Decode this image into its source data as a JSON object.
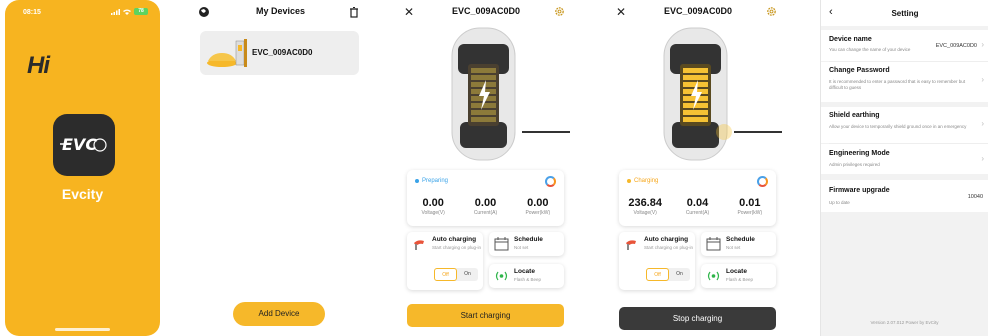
{
  "splash": {
    "time": "08:15",
    "battery": "78",
    "greeting": "Hi",
    "logo_text": "EVC",
    "brand": "Evcity"
  },
  "devices": {
    "title": "My Devices",
    "device_name": "EVC_009AC0D0",
    "add_label": "Add Device"
  },
  "preparing": {
    "title": "EVC_009AC0D0",
    "status": "Preparing",
    "status_color": "#3aa3e8",
    "metrics": [
      {
        "value": "0.00",
        "label": "Voltage(V)"
      },
      {
        "value": "0.00",
        "label": "Current(A)"
      },
      {
        "value": "0.00",
        "label": "Power(kW)"
      }
    ],
    "auto_title": "Auto charging",
    "auto_sub": "Start charging on plug-in",
    "toggle_off": "Off",
    "toggle_on": "On",
    "schedule_title": "Schedule",
    "schedule_sub": "Not set",
    "locate_title": "Locate",
    "locate_sub": "Flash & Beep",
    "action": "Start charging"
  },
  "charging": {
    "title": "EVC_009AC0D0",
    "status": "Charging",
    "status_color": "#f6b82a",
    "metrics": [
      {
        "value": "236.84",
        "label": "Voltage(V)"
      },
      {
        "value": "0.04",
        "label": "Current(A)"
      },
      {
        "value": "0.01",
        "label": "Power(kW)"
      }
    ],
    "auto_title": "Auto charging",
    "auto_sub": "Start charging on plug-in",
    "toggle_off": "Off",
    "toggle_on": "On",
    "schedule_title": "Schedule",
    "schedule_sub": "Not set",
    "locate_title": "Locate",
    "locate_sub": "Flash & Beep",
    "action": "Stop charging"
  },
  "settings": {
    "title": "Setting",
    "rows": [
      {
        "title": "Device name",
        "desc": "You can change the name of your device",
        "value": "EVC_009AC0D0"
      },
      {
        "title": "Change Password",
        "desc": "It is recommended to enter a password that is easy to remember but difficult to guess",
        "value": ""
      },
      {
        "title": "Shield earthing",
        "desc": "Allow your device to temporarily shield ground once in an emergency",
        "value": ""
      },
      {
        "title": "Engineering Mode",
        "desc": "Admin privileges required",
        "value": ""
      },
      {
        "title": "Firmware upgrade",
        "desc": "Up to date",
        "value": "10040"
      }
    ],
    "footer": "Version 2.07.012 Power by EvCity"
  },
  "colors": {
    "accent": "#f6b82a",
    "dark_button": "#3a3a3a"
  }
}
